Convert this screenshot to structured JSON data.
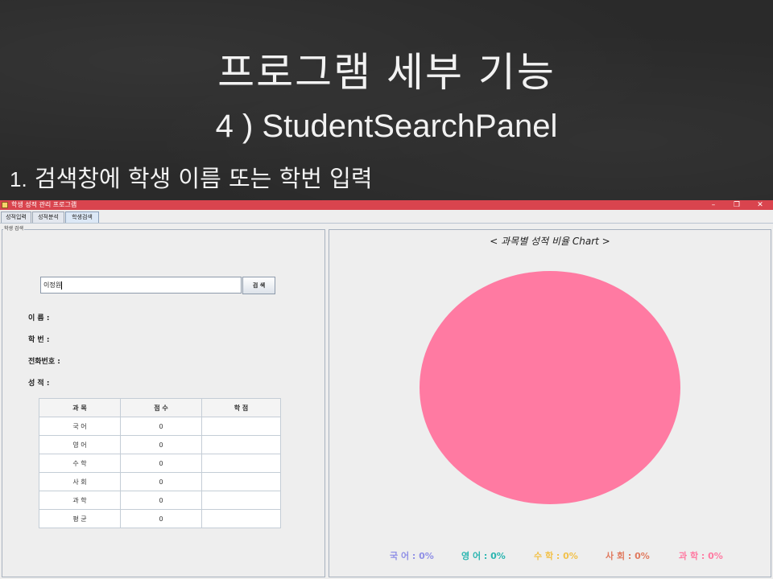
{
  "slide": {
    "title": "프로그램 세부 기능",
    "subtitle": "4 ) StudentSearchPanel",
    "bullet_num": "1.",
    "bullet_text": " 검색창에 학생 이름 또는 학번 입력"
  },
  "window": {
    "title": "학생 성적 관리 프로그램",
    "controls": {
      "minimize": "–",
      "maximize": "❐",
      "close": "✕"
    },
    "tabs": [
      {
        "label": "성적입력"
      },
      {
        "label": "성적분석"
      },
      {
        "label": "학생검색",
        "active": true
      }
    ]
  },
  "left_panel": {
    "group_label": "학생 검색",
    "search": {
      "value": "이정원",
      "button_label": "검 색"
    },
    "info_labels": [
      "이    름 :",
      "학    번 :",
      "전화번호 :",
      "성    적 :"
    ],
    "table": {
      "headers": [
        "과  목",
        "점 수",
        "학 점"
      ],
      "rows": [
        [
          "국 어",
          "0",
          ""
        ],
        [
          "영 어",
          "0",
          ""
        ],
        [
          "수 학",
          "0",
          ""
        ],
        [
          "사 회",
          "0",
          ""
        ],
        [
          "과 학",
          "0",
          ""
        ],
        [
          "평 균",
          "0",
          ""
        ]
      ]
    }
  },
  "right_panel": {
    "chart_title": "< 과목별 성적 비율 Chart >"
  },
  "chart_data": {
    "type": "pie",
    "title": "< 과목별 성적 비율 Chart >",
    "categories": [
      "국 어",
      "영 어",
      "수 학",
      "사 회",
      "과 학"
    ],
    "values": [
      0,
      0,
      0,
      0,
      0
    ],
    "legend_labels": [
      "국 어 : 0%",
      "영 어 : 0%",
      "수 학 : 0%",
      "사 회 : 0%",
      "과 학 : 0%"
    ],
    "colors": [
      "#8f8fe6",
      "#2ab5b0",
      "#f2c14a",
      "#e07a5f",
      "#ff7aa2"
    ],
    "pie_color_shown": "#ff7aa2",
    "legend_position": "bottom"
  },
  "colors": {
    "titlebar": "#d9444e",
    "window_bg": "#eeeeee"
  }
}
